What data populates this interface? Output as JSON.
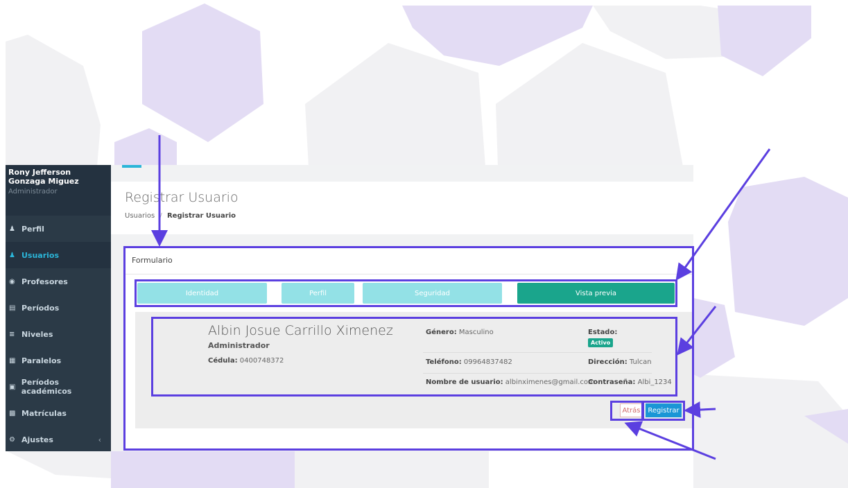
{
  "sidebar": {
    "user_name": "Rony Jefferson Gonzaga Miguez",
    "user_role": "Administrador",
    "items": [
      {
        "label": "Perfil",
        "icon": "user-icon"
      },
      {
        "label": "Usuarios",
        "icon": "users-icon",
        "active": true
      },
      {
        "label": "Profesores",
        "icon": "user-circle-icon"
      },
      {
        "label": "Períodos",
        "icon": "calendar-icon"
      },
      {
        "label": "Niveles",
        "icon": "list-icon"
      },
      {
        "label": "Paralelos",
        "icon": "table-icon"
      },
      {
        "label": "Períodos académicos",
        "icon": "calendar-alt-icon"
      },
      {
        "label": "Matrículas",
        "icon": "book-icon"
      },
      {
        "label": "Ajustes",
        "icon": "gear-icon",
        "chevron": "‹"
      }
    ]
  },
  "header": {
    "title": "Registrar Usuario",
    "breadcrumb": {
      "parent": "Usuarios",
      "separator": "/",
      "current": "Registrar Usuario"
    }
  },
  "card": {
    "title": "Formulario",
    "steps": [
      {
        "label": "Identidad",
        "active": false
      },
      {
        "label": "Perfil",
        "active": false
      },
      {
        "label": "Seguridad",
        "active": false
      },
      {
        "label": "Vista previa",
        "active": true
      }
    ]
  },
  "preview": {
    "name": "Albin Josue Carrillo Ximenez",
    "role": "Administrador",
    "cedula_label": "Cédula:",
    "cedula_value": "0400748372",
    "genero_label": "Género:",
    "genero_value": "Masculino",
    "estado_label": "Estado:",
    "estado_value": "Activo",
    "telefono_label": "Teléfono:",
    "telefono_value": "09964837482",
    "direccion_label": "Dirección:",
    "direccion_value": "Tulcan",
    "usuario_label": "Nombre de usuario:",
    "usuario_value": "albinximenes@gmail.com",
    "contrasena_label": "Contraseña:",
    "contrasena_value": "Albi_1234"
  },
  "buttons": {
    "back": "Atrás",
    "register": "Registrar"
  },
  "colors": {
    "sidebar_bg": "#2b3a47",
    "accent": "#2bb5d8",
    "step_inactive": "#93e1e6",
    "step_active": "#1aa58c",
    "badge": "#1aa58c",
    "register_btn": "#1a96d6",
    "annotation": "#5b3fe0",
    "hexagon": "#e3dcf4"
  }
}
